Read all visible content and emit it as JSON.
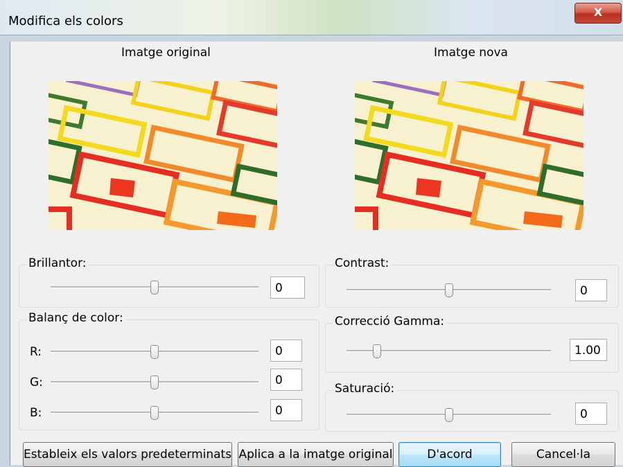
{
  "window": {
    "title": "Modifica els colors",
    "close_label": "X"
  },
  "previews": {
    "original_label": "Imatge original",
    "new_label": "Imatge nova"
  },
  "brightness": {
    "label": "Brillantor:",
    "value": "0",
    "level": 0.5
  },
  "color_balance": {
    "label": "Balanç de color:",
    "r": {
      "label": "R:",
      "value": "0",
      "level": 0.5
    },
    "g": {
      "label": "G:",
      "value": "0",
      "level": 0.5
    },
    "b": {
      "label": "B:",
      "value": "0",
      "level": 0.5
    }
  },
  "contrast": {
    "label": "Contrast:",
    "value": "0",
    "level": 0.5
  },
  "gamma": {
    "label": "Correcció Gamma:",
    "value": "1.00",
    "level": 0.15
  },
  "saturation": {
    "label": "Saturació:",
    "value": "0",
    "level": 0.5
  },
  "buttons": {
    "defaults": "Estableix els valors predeterminats",
    "apply_original": "Aplica a la imatge original",
    "ok": "D'acord",
    "cancel": "Cancel·la"
  },
  "colors": {
    "accent": "#3c7fb1",
    "close_red": "#c4493a"
  }
}
